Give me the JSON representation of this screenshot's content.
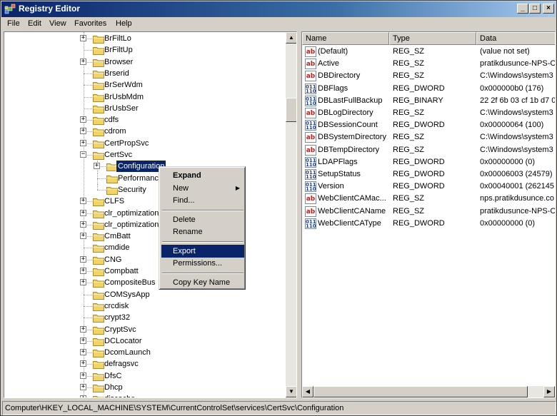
{
  "window": {
    "title": "Registry Editor"
  },
  "caption_buttons": {
    "minimize": "_",
    "maximize": "□",
    "close": "×"
  },
  "menu": [
    "File",
    "Edit",
    "View",
    "Favorites",
    "Help"
  ],
  "tree": {
    "items": [
      {
        "label": "BrFiltLo",
        "expander": "+"
      },
      {
        "label": "BrFiltUp",
        "expander": ""
      },
      {
        "label": "Browser",
        "expander": "+"
      },
      {
        "label": "Brserid",
        "expander": ""
      },
      {
        "label": "BrSerWdm",
        "expander": ""
      },
      {
        "label": "BrUsbMdm",
        "expander": ""
      },
      {
        "label": "BrUsbSer",
        "expander": ""
      },
      {
        "label": "cdfs",
        "expander": "+"
      },
      {
        "label": "cdrom",
        "expander": "+"
      },
      {
        "label": "CertPropSvc",
        "expander": "+"
      },
      {
        "label": "CertSvc",
        "expander": "−"
      },
      {
        "label": "Configuration",
        "expander": "+",
        "child": true,
        "selected": true
      },
      {
        "label": "Performance",
        "expander": "",
        "child": true
      },
      {
        "label": "Security",
        "expander": "",
        "child": true
      },
      {
        "label": "CLFS",
        "expander": "+"
      },
      {
        "label": "clr_optimization_",
        "expander": "+"
      },
      {
        "label": "clr_optimization_",
        "expander": "+"
      },
      {
        "label": "CmBatt",
        "expander": "+"
      },
      {
        "label": "cmdide",
        "expander": ""
      },
      {
        "label": "CNG",
        "expander": "+"
      },
      {
        "label": "Compbatt",
        "expander": "+"
      },
      {
        "label": "CompositeBus",
        "expander": "+"
      },
      {
        "label": "COMSysApp",
        "expander": ""
      },
      {
        "label": "crcdisk",
        "expander": ""
      },
      {
        "label": "crypt32",
        "expander": ""
      },
      {
        "label": "CryptSvc",
        "expander": "+"
      },
      {
        "label": "DCLocator",
        "expander": "+"
      },
      {
        "label": "DcomLaunch",
        "expander": "+"
      },
      {
        "label": "defragsvc",
        "expander": "+"
      },
      {
        "label": "DfsC",
        "expander": "+"
      },
      {
        "label": "Dhcp",
        "expander": "+"
      },
      {
        "label": "discache",
        "expander": "+"
      }
    ]
  },
  "list": {
    "columns": [
      "Name",
      "Type",
      "Data"
    ],
    "rows": [
      {
        "kind": "sz",
        "name": "(Default)",
        "type": "REG_SZ",
        "data": "(value not set)"
      },
      {
        "kind": "sz",
        "name": "Active",
        "type": "REG_SZ",
        "data": "pratikdusunce-NPS-C"
      },
      {
        "kind": "sz",
        "name": "DBDirectory",
        "type": "REG_SZ",
        "data": "C:\\Windows\\system3"
      },
      {
        "kind": "dw",
        "name": "DBFlags",
        "type": "REG_DWORD",
        "data": "0x000000b0 (176)"
      },
      {
        "kind": "dw",
        "name": "DBLastFullBackup",
        "type": "REG_BINARY",
        "data": "22 2f 6b 03 cf 1b d7 0"
      },
      {
        "kind": "sz",
        "name": "DBLogDirectory",
        "type": "REG_SZ",
        "data": "C:\\Windows\\system3"
      },
      {
        "kind": "dw",
        "name": "DBSessionCount",
        "type": "REG_DWORD",
        "data": "0x00000064 (100)"
      },
      {
        "kind": "sz",
        "name": "DBSystemDirectory",
        "type": "REG_SZ",
        "data": "C:\\Windows\\system3"
      },
      {
        "kind": "sz",
        "name": "DBTempDirectory",
        "type": "REG_SZ",
        "data": "C:\\Windows\\system3"
      },
      {
        "kind": "dw",
        "name": "LDAPFlags",
        "type": "REG_DWORD",
        "data": "0x00000000 (0)"
      },
      {
        "kind": "dw",
        "name": "SetupStatus",
        "type": "REG_DWORD",
        "data": "0x00006003 (24579)"
      },
      {
        "kind": "dw",
        "name": "Version",
        "type": "REG_DWORD",
        "data": "0x00040001 (262145"
      },
      {
        "kind": "sz",
        "name": "WebClientCAMac...",
        "type": "REG_SZ",
        "data": "nps.pratikdusunce.co"
      },
      {
        "kind": "sz",
        "name": "WebClientCAName",
        "type": "REG_SZ",
        "data": "pratikdusunce-NPS-C"
      },
      {
        "kind": "dw",
        "name": "WebClientCAType",
        "type": "REG_DWORD",
        "data": "0x00000000 (0)"
      }
    ]
  },
  "context_menu": {
    "items": [
      {
        "label": "Expand",
        "bold": true
      },
      {
        "label": "New",
        "submenu": true
      },
      {
        "label": "Find..."
      },
      {
        "sep": true
      },
      {
        "label": "Delete"
      },
      {
        "label": "Rename"
      },
      {
        "sep": true
      },
      {
        "label": "Export",
        "highlight": true
      },
      {
        "label": "Permissions..."
      },
      {
        "sep": true
      },
      {
        "label": "Copy Key Name"
      }
    ]
  },
  "icons": {
    "string_value": "ab",
    "dword_value": "011\n110"
  },
  "statusbar": {
    "path": "Computer\\HKEY_LOCAL_MACHINE\\SYSTEM\\CurrentControlSet\\services\\CertSvc\\Configuration"
  },
  "colors": {
    "selection": "#0a246a",
    "folder": "#f1d36b",
    "chrome": "#d4d0c8"
  }
}
